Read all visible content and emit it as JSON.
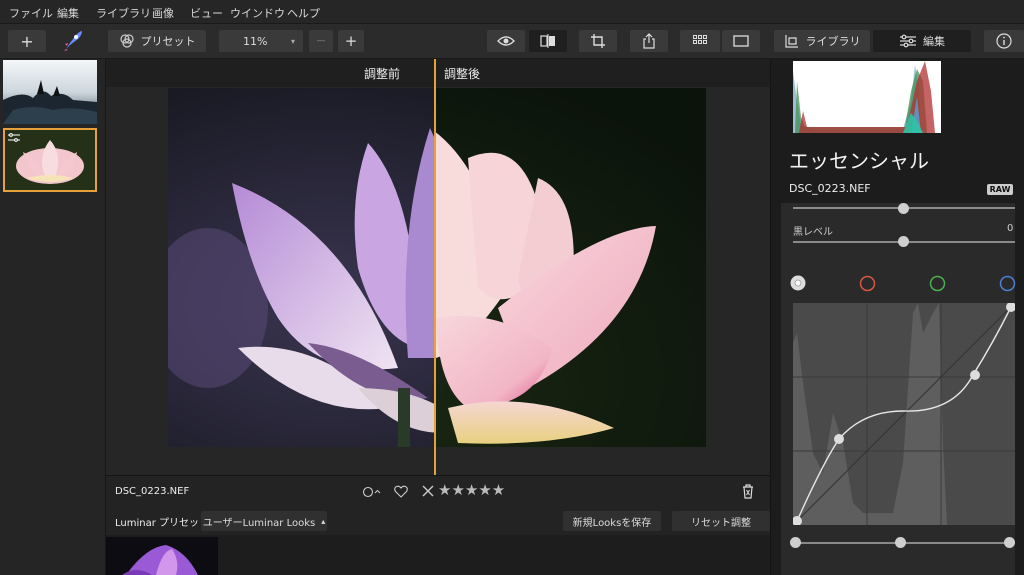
{
  "menu": [
    "ファイル",
    "編集",
    "ライブラリ",
    "画像",
    "ビュー",
    "ウインドウ",
    "ヘルプ"
  ],
  "toolbar": {
    "add_label": "+",
    "preset_label": "プリセット",
    "zoom_value": "11%",
    "zoom_out_label": "—",
    "zoom_in_label": "+",
    "library_tab": "ライブラリ",
    "edit_tab": "編集"
  },
  "compare": {
    "before_label": "調整前",
    "after_label": "調整後"
  },
  "info": {
    "filename": "DSC_0223.NEF"
  },
  "presets": {
    "label": "Luminar プリセット",
    "category": "ユーザーLuminar Looks",
    "save_label": "新規Looksを保存",
    "reset_label": "リセット調整"
  },
  "panel": {
    "title": "エッセンシャル",
    "filename": "DSC_0223.NEF",
    "raw_badge": "RAW",
    "black_level_label": "黒レベル",
    "black_level_value": "0"
  },
  "colors": {
    "accent": "#e6a23a",
    "curve_red": "#d9573f",
    "curve_green": "#4caf50",
    "curve_blue": "#4a7fd6"
  }
}
